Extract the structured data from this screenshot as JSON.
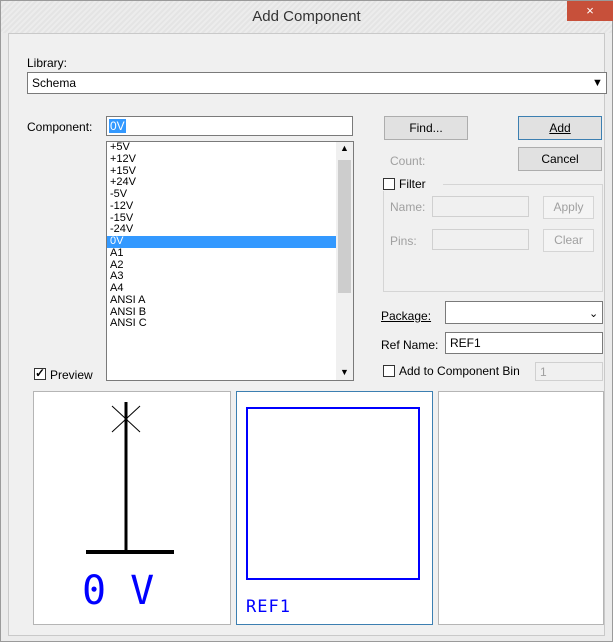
{
  "window": {
    "title": "Add Component",
    "close_glyph": "×"
  },
  "library": {
    "label": "Library:",
    "value": "Schema"
  },
  "component": {
    "label": "Component:",
    "value": "0V",
    "items": [
      "+5V",
      "+12V",
      "+15V",
      "+24V",
      "-5V",
      "-12V",
      "-15V",
      "-24V",
      "0V",
      "A1",
      "A2",
      "A3",
      "A4",
      "ANSI A",
      "ANSI B",
      "ANSI C"
    ],
    "selected_index": 8
  },
  "buttons": {
    "find": "Find...",
    "add": "Add",
    "cancel": "Cancel",
    "apply": "Apply",
    "clear": "Clear"
  },
  "count": {
    "label": "Count:"
  },
  "filter": {
    "label": "Filter",
    "name_label": "Name:",
    "pins_label": "Pins:",
    "checked": false
  },
  "package": {
    "label": "Package:",
    "value": ""
  },
  "ref_name": {
    "label": "Ref Name:",
    "value": "REF1"
  },
  "component_bin": {
    "label": "Add to Component Bin",
    "value": "1",
    "checked": false
  },
  "preview": {
    "label": "Preview",
    "checked": true
  },
  "previews": {
    "symbol_text": "0 V",
    "footprint_text": "REF1"
  },
  "colors": {
    "selection": "#3399ff",
    "preview_drawing": "#0000ff",
    "title_close": "#c7503a"
  }
}
